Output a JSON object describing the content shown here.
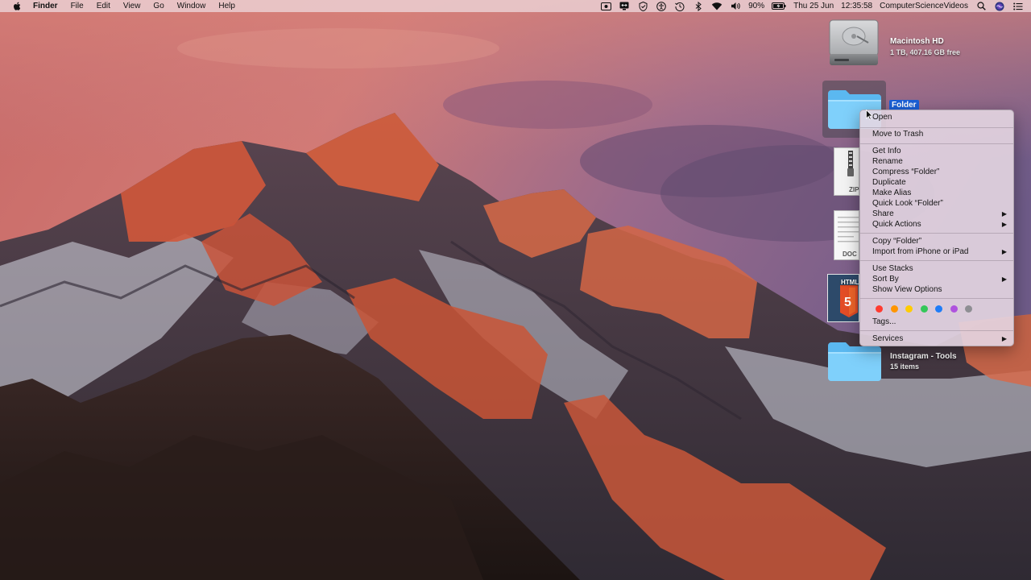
{
  "menubar": {
    "apple_icon": "apple-logo-icon",
    "items": [
      "Finder",
      "File",
      "Edit",
      "View",
      "Go",
      "Window",
      "Help"
    ],
    "status_icons": [
      "screen-record-icon",
      "teamviewer-icon",
      "antivirus-icon",
      "accessibility-icon",
      "time-machine-icon",
      "bluetooth-icon",
      "wifi-icon",
      "volume-icon"
    ],
    "battery": "90%",
    "battery_icon": "battery-charging-icon",
    "date": "Thu 25 Jun",
    "time": "12:35:58",
    "user": "ComputerScienceVideos",
    "search_icon": "spotlight-search-icon",
    "siri_icon": "siri-icon",
    "control_icon": "notification-center-icon"
  },
  "desktop": {
    "drive": {
      "name": "Macintosh HD",
      "info": "1 TB, 407.16 GB free"
    },
    "selected_folder": {
      "name": "Folder"
    },
    "zip_file": {
      "badge": "ZIP"
    },
    "doc_file": {
      "badge": "DOC"
    },
    "html_file": {
      "badge": "HTML"
    },
    "folder2": {
      "name": "Instagram - Tools",
      "info": "15 items"
    }
  },
  "context_menu": {
    "open": "Open",
    "move_to_trash": "Move to Trash",
    "get_info": "Get Info",
    "rename": "Rename",
    "compress": "Compress “Folder”",
    "duplicate": "Duplicate",
    "make_alias": "Make Alias",
    "quick_look": "Quick Look “Folder”",
    "share": "Share",
    "quick_actions": "Quick Actions",
    "copy": "Copy “Folder”",
    "import": "Import from iPhone or iPad",
    "use_stacks": "Use Stacks",
    "sort_by": "Sort By",
    "show_view_options": "Show View Options",
    "tags": "Tags...",
    "services": "Services",
    "submenu_arrow": "▶",
    "tag_colors": [
      "#ff3b30",
      "#ff9500",
      "#ffcc00",
      "#34c759",
      "#1e7cf7",
      "#af52de",
      "#8e8e93"
    ]
  }
}
